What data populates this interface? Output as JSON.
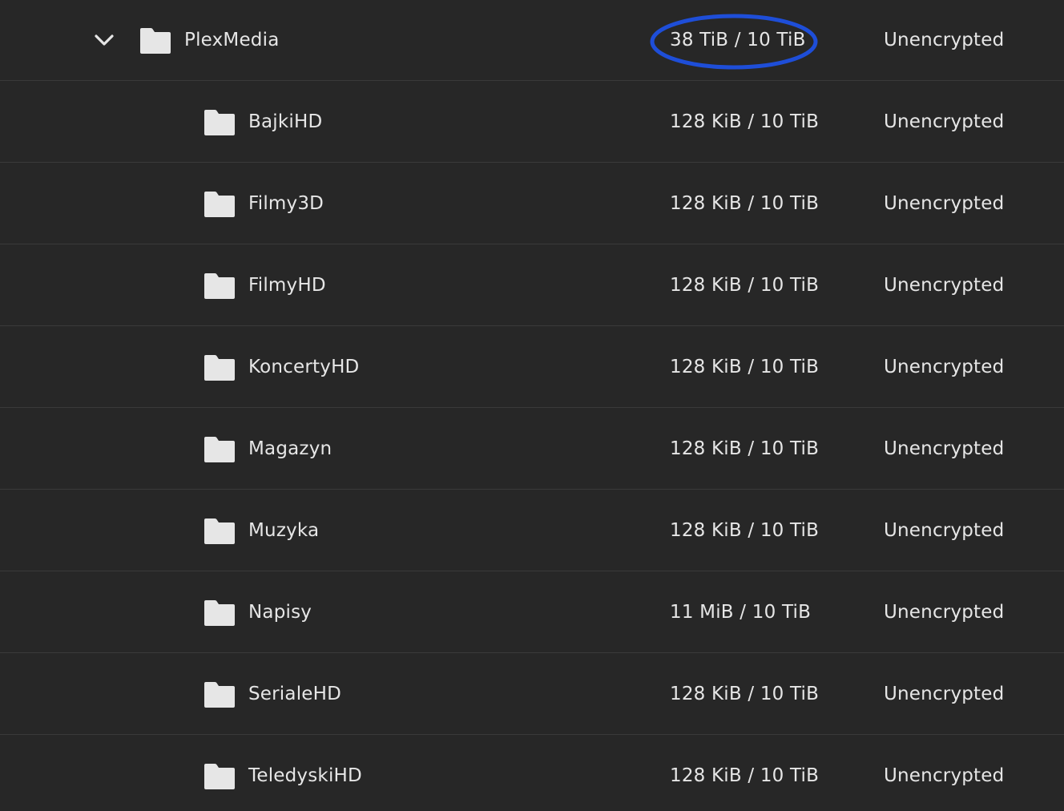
{
  "parent": {
    "name": "PlexMedia",
    "usage": "38 TiB / 10 TiB",
    "encryption": "Unencrypted",
    "expanded": true,
    "usage_highlight_color": "#1e4ed8"
  },
  "children": [
    {
      "name": "BajkiHD",
      "usage": "128 KiB / 10 TiB",
      "encryption": "Unencrypted"
    },
    {
      "name": "Filmy3D",
      "usage": "128 KiB / 10 TiB",
      "encryption": "Unencrypted"
    },
    {
      "name": "FilmyHD",
      "usage": "128 KiB / 10 TiB",
      "encryption": "Unencrypted"
    },
    {
      "name": "KoncertyHD",
      "usage": "128 KiB / 10 TiB",
      "encryption": "Unencrypted"
    },
    {
      "name": "Magazyn",
      "usage": "128 KiB / 10 TiB",
      "encryption": "Unencrypted"
    },
    {
      "name": "Muzyka",
      "usage": "128 KiB / 10 TiB",
      "encryption": "Unencrypted"
    },
    {
      "name": "Napisy",
      "usage": "11 MiB / 10 TiB",
      "encryption": "Unencrypted"
    },
    {
      "name": "SerialeHD",
      "usage": "128 KiB / 10 TiB",
      "encryption": "Unencrypted"
    },
    {
      "name": "TeledyskiHD",
      "usage": "128 KiB / 10 TiB",
      "encryption": "Unencrypted"
    }
  ],
  "colors": {
    "background": "#272727",
    "divider": "#3a3a3a",
    "text": "#e6e6e6",
    "folder_icon": "#e6e6e6"
  }
}
